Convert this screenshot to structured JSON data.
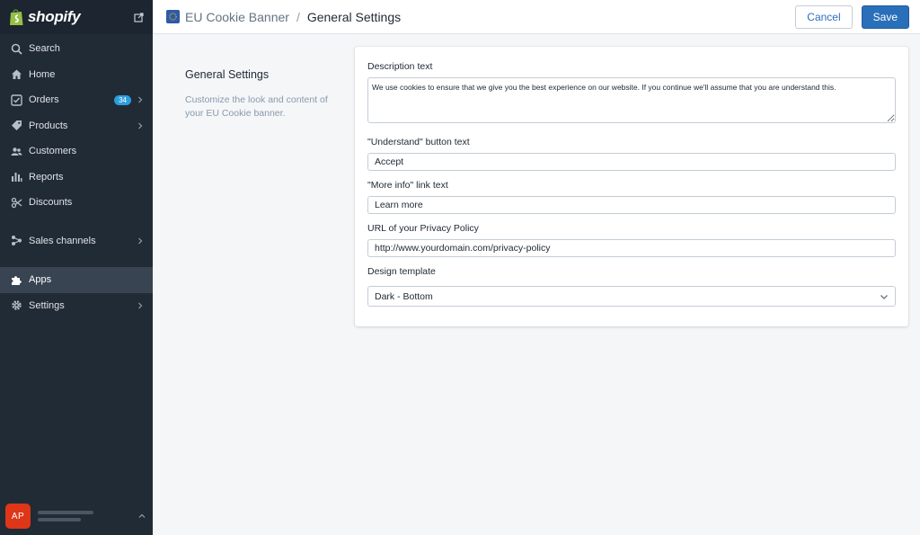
{
  "brand": {
    "name": "shopify",
    "icon": "shopping-bag-icon"
  },
  "sidebar": {
    "items": [
      {
        "label": "Search",
        "icon": "search-icon"
      },
      {
        "label": "Home",
        "icon": "home-icon"
      },
      {
        "label": "Orders",
        "icon": "orders-icon",
        "badge": "34"
      },
      {
        "label": "Products",
        "icon": "tag-icon"
      },
      {
        "label": "Customers",
        "icon": "customers-icon"
      },
      {
        "label": "Reports",
        "icon": "reports-icon"
      },
      {
        "label": "Discounts",
        "icon": "discounts-icon"
      },
      {
        "label": "Sales channels",
        "icon": "sales-channels-icon"
      },
      {
        "label": "Apps",
        "icon": "puzzle-icon",
        "active": true
      },
      {
        "label": "Settings",
        "icon": "gear-icon"
      }
    ],
    "account": {
      "initials": "AP"
    }
  },
  "header": {
    "app_name": "EU Cookie Banner",
    "separator": "/",
    "page_title": "General Settings",
    "cancel_label": "Cancel",
    "save_label": "Save"
  },
  "section": {
    "title": "General Settings",
    "description": "Customize the look and content of your EU Cookie banner."
  },
  "form": {
    "description": {
      "label": "Description text",
      "value": "We use cookies to ensure that we give you the best experience on our website. If you continue we'll assume that you are understand this."
    },
    "understand": {
      "label": "\"Understand\" button text",
      "value": "Accept"
    },
    "more_info": {
      "label": "\"More info\" link text",
      "value": "Learn more"
    },
    "privacy_url": {
      "label": "URL of your Privacy Policy",
      "value": "http://www.yourdomain.com/privacy-policy"
    },
    "design": {
      "label": "Design template",
      "value": "Dark - Bottom"
    }
  },
  "colors": {
    "sidebar_bg": "#212b36",
    "accent": "#2a6fb9",
    "badge": "#2d9ee0",
    "avatar": "#de3618"
  }
}
